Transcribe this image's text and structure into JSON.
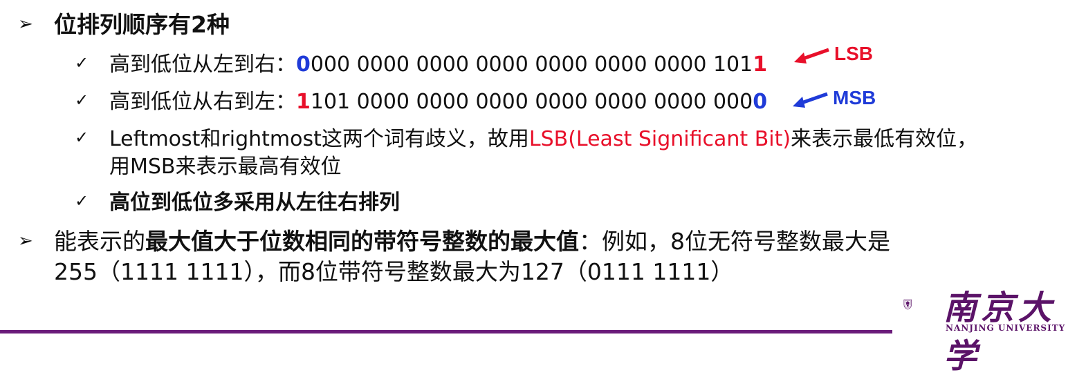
{
  "heading1": "位排列顺序有2种",
  "row1": {
    "prefix": "高到低位从左到右：",
    "first_bit": "0",
    "middle": "000 0000 0000 0000 0000 0000 0000 101",
    "last_bit": "1",
    "tag": "LSB"
  },
  "row2": {
    "prefix": "高到低位从右到左：",
    "first_bit": "1",
    "middle": "101 0000 0000 0000 0000 0000 0000 000",
    "last_bit": "0",
    "tag": "MSB"
  },
  "row3": {
    "line1_a": "Leftmost和rightmost这两个词有歧义，故用",
    "line1_red": "LSB(Least Significant Bit)",
    "line1_b": "来表示最低有效位，",
    "line2": "用MSB来表示最高有效位"
  },
  "row4": "高位到低位多采用从左往右排列",
  "heading2": {
    "a": "能表示的",
    "b_bold": "最大值大于位数相同的带符号整数的最大值",
    "c": "：例如，8位无符号整数最大是",
    "line2": "255（1111 1111），而8位带符号整数最大为127（0111 1111）"
  },
  "markers": {
    "level1": "➢",
    "level2": "✓"
  },
  "logo": {
    "cn": "南京大学",
    "en": "NANJING UNIVERSITY"
  },
  "colors": {
    "red": "#e8102a",
    "blue": "#1f3bd8",
    "brand_purple": "#6a1b7a"
  }
}
